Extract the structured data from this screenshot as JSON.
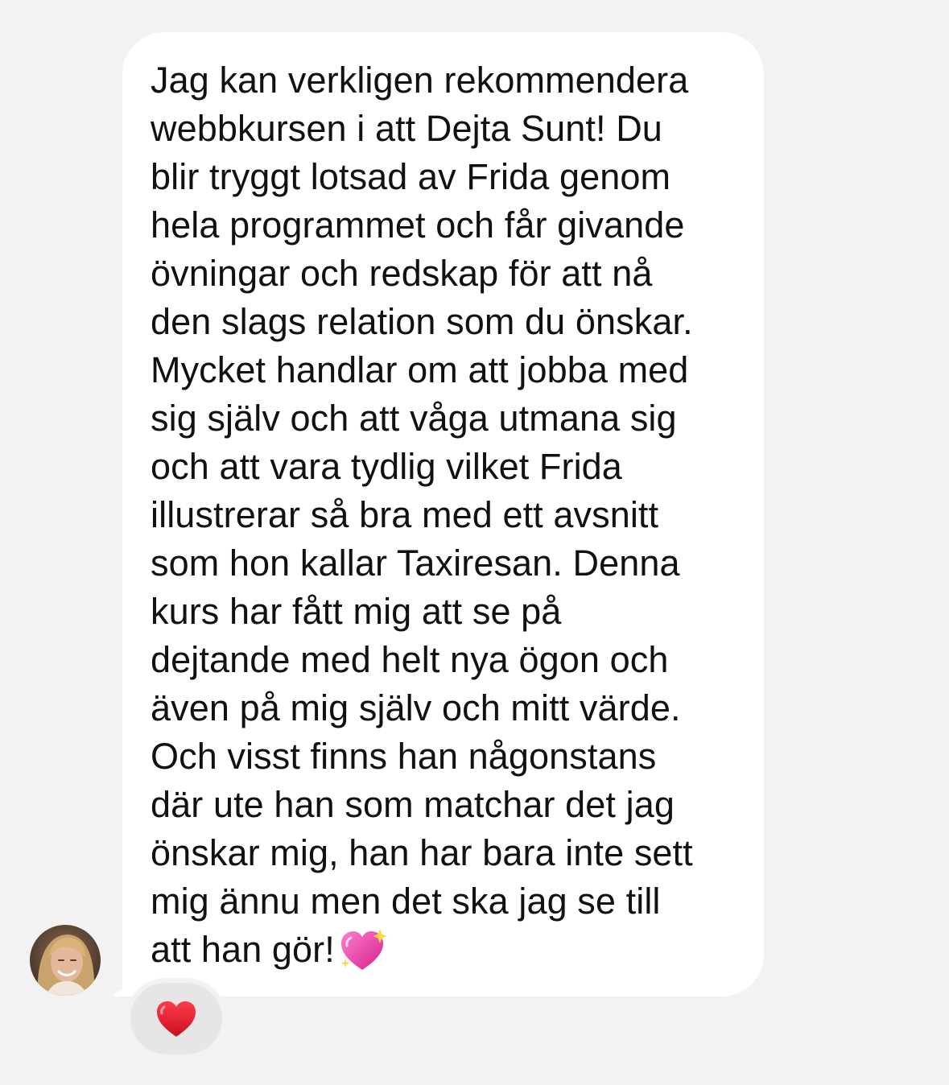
{
  "message": {
    "lines": [
      "Jag kan verkligen rekommendera",
      "webbkursen i att Dejta Sunt! Du",
      "blir tryggt lotsad av Frida genom",
      "hela programmet och får givande",
      "övningar och redskap för att nå",
      "den slags relation som du önskar.",
      "Mycket handlar om att jobba med",
      "sig själv och att våga utmana sig",
      "och att vara tydlig vilket Frida",
      "illustrerar så bra med ett avsnitt",
      "som hon kallar Taxiresan. Denna",
      "kurs har fått mig att se på",
      "dejtande med helt nya ögon och",
      "även på mig själv och mitt värde.",
      "Och visst finns han någonstans",
      "där ute han som matchar det jag",
      "önskar mig, han har bara inte sett",
      "mig ännu men det ska jag se till",
      "att han gör!"
    ],
    "trailing_emoji": "sparkling-heart-icon"
  },
  "sender": {
    "avatar": "avatar-photo"
  },
  "reaction": {
    "emoji": "red-heart-icon"
  },
  "colors": {
    "background": "#f2f2f2",
    "bubble": "#ffffff",
    "text": "#111111",
    "reaction_pill": "#e6e6e6",
    "heart": "#e0162b",
    "sparkle_heart": "#f04fb0"
  }
}
